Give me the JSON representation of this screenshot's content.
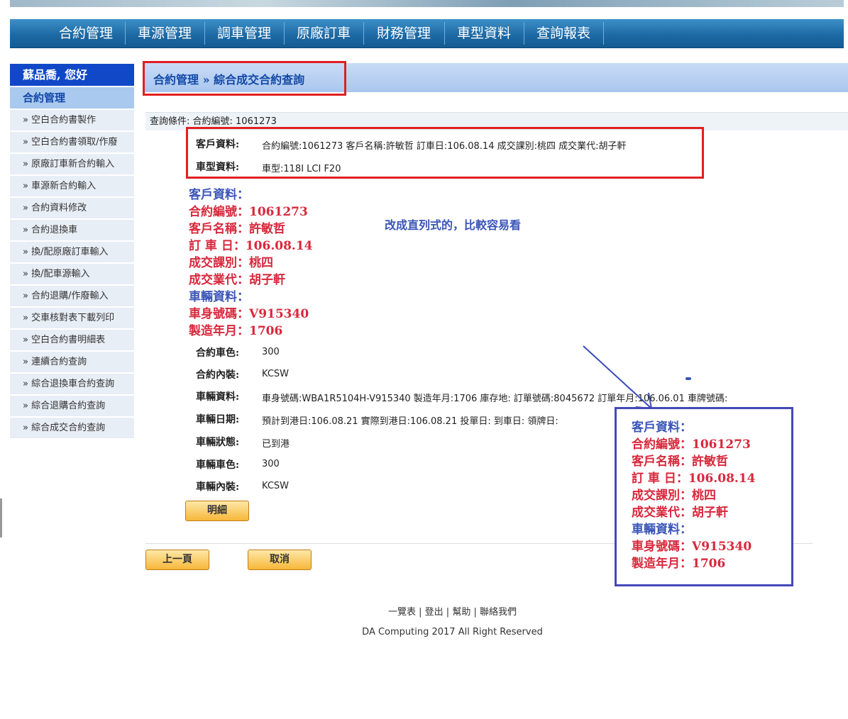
{
  "nav": [
    "合約管理",
    "車源管理",
    "調車管理",
    "原廠訂車",
    "財務管理",
    "車型資料",
    "查詢報表"
  ],
  "sidebar": {
    "greeting": "蘇品喬, 您好",
    "section": "合約管理",
    "items": [
      "» 空白合約書製作",
      "» 空白合約書領取/作廢",
      "» 原廠訂車新合約輸入",
      "» 車源新合約輸入",
      "» 合約資料修改",
      "» 合約退換車",
      "» 換/配原廠訂車輸入",
      "» 換/配車源輸入",
      "» 合約退購/作廢輸入",
      "» 交車核對表下載列印",
      "» 空白合約書明細表",
      "» 連續合約查詢",
      "» 綜合退換車合約查詢",
      "» 綜合退購合約查詢",
      "» 綜合成交合約查詢"
    ]
  },
  "breadcrumb": "合約管理 » 綜合成交合約查詢",
  "query": "查詢條件:   合約編號: 1061273",
  "form": {
    "customer_label": "客戶資料:",
    "customer_value": "合約編號:1061273   客戶名稱:許敏哲    訂車日:106.08.14    成交課別:桃四    成交業代:胡子軒",
    "model_label": "車型資料:",
    "model_value": "車型:118I LCI F20",
    "color_label": "合約車色:",
    "color_value": "300",
    "interior_label": "合約內裝:",
    "interior_value": "KCSW",
    "vehicle_label": "車輛資料:",
    "vehicle_value": "車身號碼:WBA1R5104H-V915340    製造年月:1706    庫存地:    訂單號碼:8045672    訂單年月:106.06.01    車牌號碼:",
    "date_label": "車輛日期:",
    "date_value": "預計到港日:106.08.21    實際到港日:106.08.21    投單日:    到車日:    領牌日:",
    "status_label": "車輛狀態:",
    "status_value": "已到港",
    "vcolor_label": "車輛車色:",
    "vcolor_value": "300",
    "vinterior_label": "車輛內裝:",
    "vinterior_value": "KCSW",
    "detail_button": "明細"
  },
  "annotation": {
    "lines": [
      {
        "text": "客戶資料：",
        "color": "blue"
      },
      {
        "text": "合約編號：1061273",
        "color": "red"
      },
      {
        "text": "客戶名稱：許敏哲",
        "color": "red"
      },
      {
        "text": "訂 車 日：106.08.14",
        "color": "red"
      },
      {
        "text": "成交課別：桃四",
        "color": "red"
      },
      {
        "text": "成交業代：胡子軒",
        "color": "red"
      },
      {
        "text": "車輛資料：",
        "color": "blue"
      },
      {
        "text": "車身號碼：V915340",
        "color": "red"
      },
      {
        "text": "製造年月：1706",
        "color": "red"
      }
    ],
    "note": "改成直列式的，比較容易看"
  },
  "buttons": {
    "prev": "上一頁",
    "cancel": "取消"
  },
  "footer": {
    "links": "一覽表 | 登出 | 幫助 | 聯絡我們",
    "copyright": "DA Computing 2017 All Right Reserved"
  },
  "colors": {
    "nav": "#1e6aa5",
    "red": "#d8283c",
    "blue": "#3a55b8",
    "highlight_red": "#e02020",
    "highlight_blue": "#4448b8"
  }
}
